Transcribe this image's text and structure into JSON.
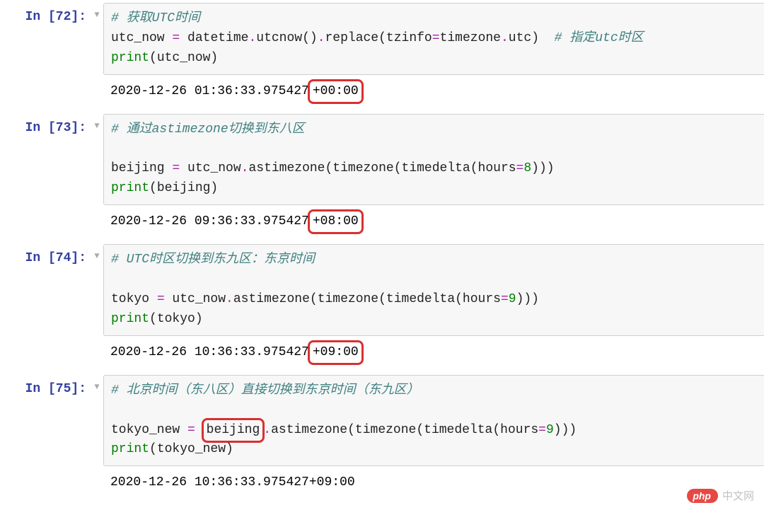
{
  "cells": [
    {
      "prompt": "In [72]:",
      "code": [
        [
          {
            "t": "# 获取UTC时间",
            "c": "c-comment"
          }
        ],
        [
          {
            "t": "utc_now ",
            "c": "c-name"
          },
          {
            "t": "=",
            "c": "c-op"
          },
          {
            "t": " datetime",
            "c": "c-name"
          },
          {
            "t": ".",
            "c": "c-op"
          },
          {
            "t": "utcnow",
            "c": "c-name"
          },
          {
            "t": "()",
            "c": "c-punct"
          },
          {
            "t": ".",
            "c": "c-op"
          },
          {
            "t": "replace",
            "c": "c-name"
          },
          {
            "t": "(tzinfo",
            "c": "c-punct"
          },
          {
            "t": "=",
            "c": "c-op"
          },
          {
            "t": "timezone",
            "c": "c-name"
          },
          {
            "t": ".",
            "c": "c-op"
          },
          {
            "t": "utc)  ",
            "c": "c-name"
          },
          {
            "t": "# 指定utc时区",
            "c": "c-comment"
          }
        ],
        [
          {
            "t": "print",
            "c": "c-builtin"
          },
          {
            "t": "(utc_now)",
            "c": "c-punct"
          }
        ]
      ],
      "output_pre": "2020-12-26 01:36:33.975427",
      "highlight": "+00:00",
      "output_post": ""
    },
    {
      "prompt": "In [73]:",
      "code": [
        [
          {
            "t": "# 通过astimezone切换到东八区",
            "c": "c-comment"
          }
        ],
        [
          {
            "t": "",
            "c": "c-name"
          }
        ],
        [
          {
            "t": "beijing ",
            "c": "c-name"
          },
          {
            "t": "=",
            "c": "c-op"
          },
          {
            "t": " utc_now",
            "c": "c-name"
          },
          {
            "t": ".",
            "c": "c-op"
          },
          {
            "t": "astimezone",
            "c": "c-name"
          },
          {
            "t": "(timezone(timedelta(hours",
            "c": "c-punct"
          },
          {
            "t": "=",
            "c": "c-op"
          },
          {
            "t": "8",
            "c": "c-num"
          },
          {
            "t": ")))",
            "c": "c-punct"
          }
        ],
        [
          {
            "t": "print",
            "c": "c-builtin"
          },
          {
            "t": "(beijing)",
            "c": "c-punct"
          }
        ]
      ],
      "output_pre": "2020-12-26 09:36:33.975427",
      "highlight": "+08:00",
      "output_post": ""
    },
    {
      "prompt": "In [74]:",
      "code": [
        [
          {
            "t": "# UTC时区切换到东九区：东京时间",
            "c": "c-comment"
          }
        ],
        [
          {
            "t": "",
            "c": "c-name"
          }
        ],
        [
          {
            "t": "tokyo ",
            "c": "c-name"
          },
          {
            "t": "=",
            "c": "c-op"
          },
          {
            "t": " utc_now",
            "c": "c-name"
          },
          {
            "t": ".",
            "c": "c-op"
          },
          {
            "t": "astimezone",
            "c": "c-name"
          },
          {
            "t": "(timezone(timedelta(hours",
            "c": "c-punct"
          },
          {
            "t": "=",
            "c": "c-op"
          },
          {
            "t": "9",
            "c": "c-num"
          },
          {
            "t": ")))",
            "c": "c-punct"
          }
        ],
        [
          {
            "t": "print",
            "c": "c-builtin"
          },
          {
            "t": "(tokyo)",
            "c": "c-punct"
          }
        ]
      ],
      "output_pre": "2020-12-26 10:36:33.975427",
      "highlight": "+09:00",
      "output_post": ""
    },
    {
      "prompt": "In [75]:",
      "code": [
        [
          {
            "t": "# 北京时间（东八区）直接切换到东京时间（东九区）",
            "c": "c-comment"
          }
        ],
        [
          {
            "t": "",
            "c": "c-name"
          }
        ],
        [
          {
            "t": "tokyo_new ",
            "c": "c-name"
          },
          {
            "t": "=",
            "c": "c-op"
          },
          {
            "t": " ",
            "c": "c-name"
          },
          {
            "t": "beijing",
            "c": "c-name",
            "hl": true
          },
          {
            "t": ".",
            "c": "c-op"
          },
          {
            "t": "astimezone",
            "c": "c-name"
          },
          {
            "t": "(timezone(timedelta(hours",
            "c": "c-punct"
          },
          {
            "t": "=",
            "c": "c-op"
          },
          {
            "t": "9",
            "c": "c-num"
          },
          {
            "t": ")))",
            "c": "c-punct"
          }
        ],
        [
          {
            "t": "print",
            "c": "c-builtin"
          },
          {
            "t": "(tokyo_new)",
            "c": "c-punct"
          }
        ]
      ],
      "output_pre": "2020-12-26 10:36:33.975427+09:00",
      "highlight": "",
      "output_post": ""
    }
  ],
  "collapser_glyph": "▼",
  "watermark": {
    "pill": "php",
    "text": "中文网"
  }
}
